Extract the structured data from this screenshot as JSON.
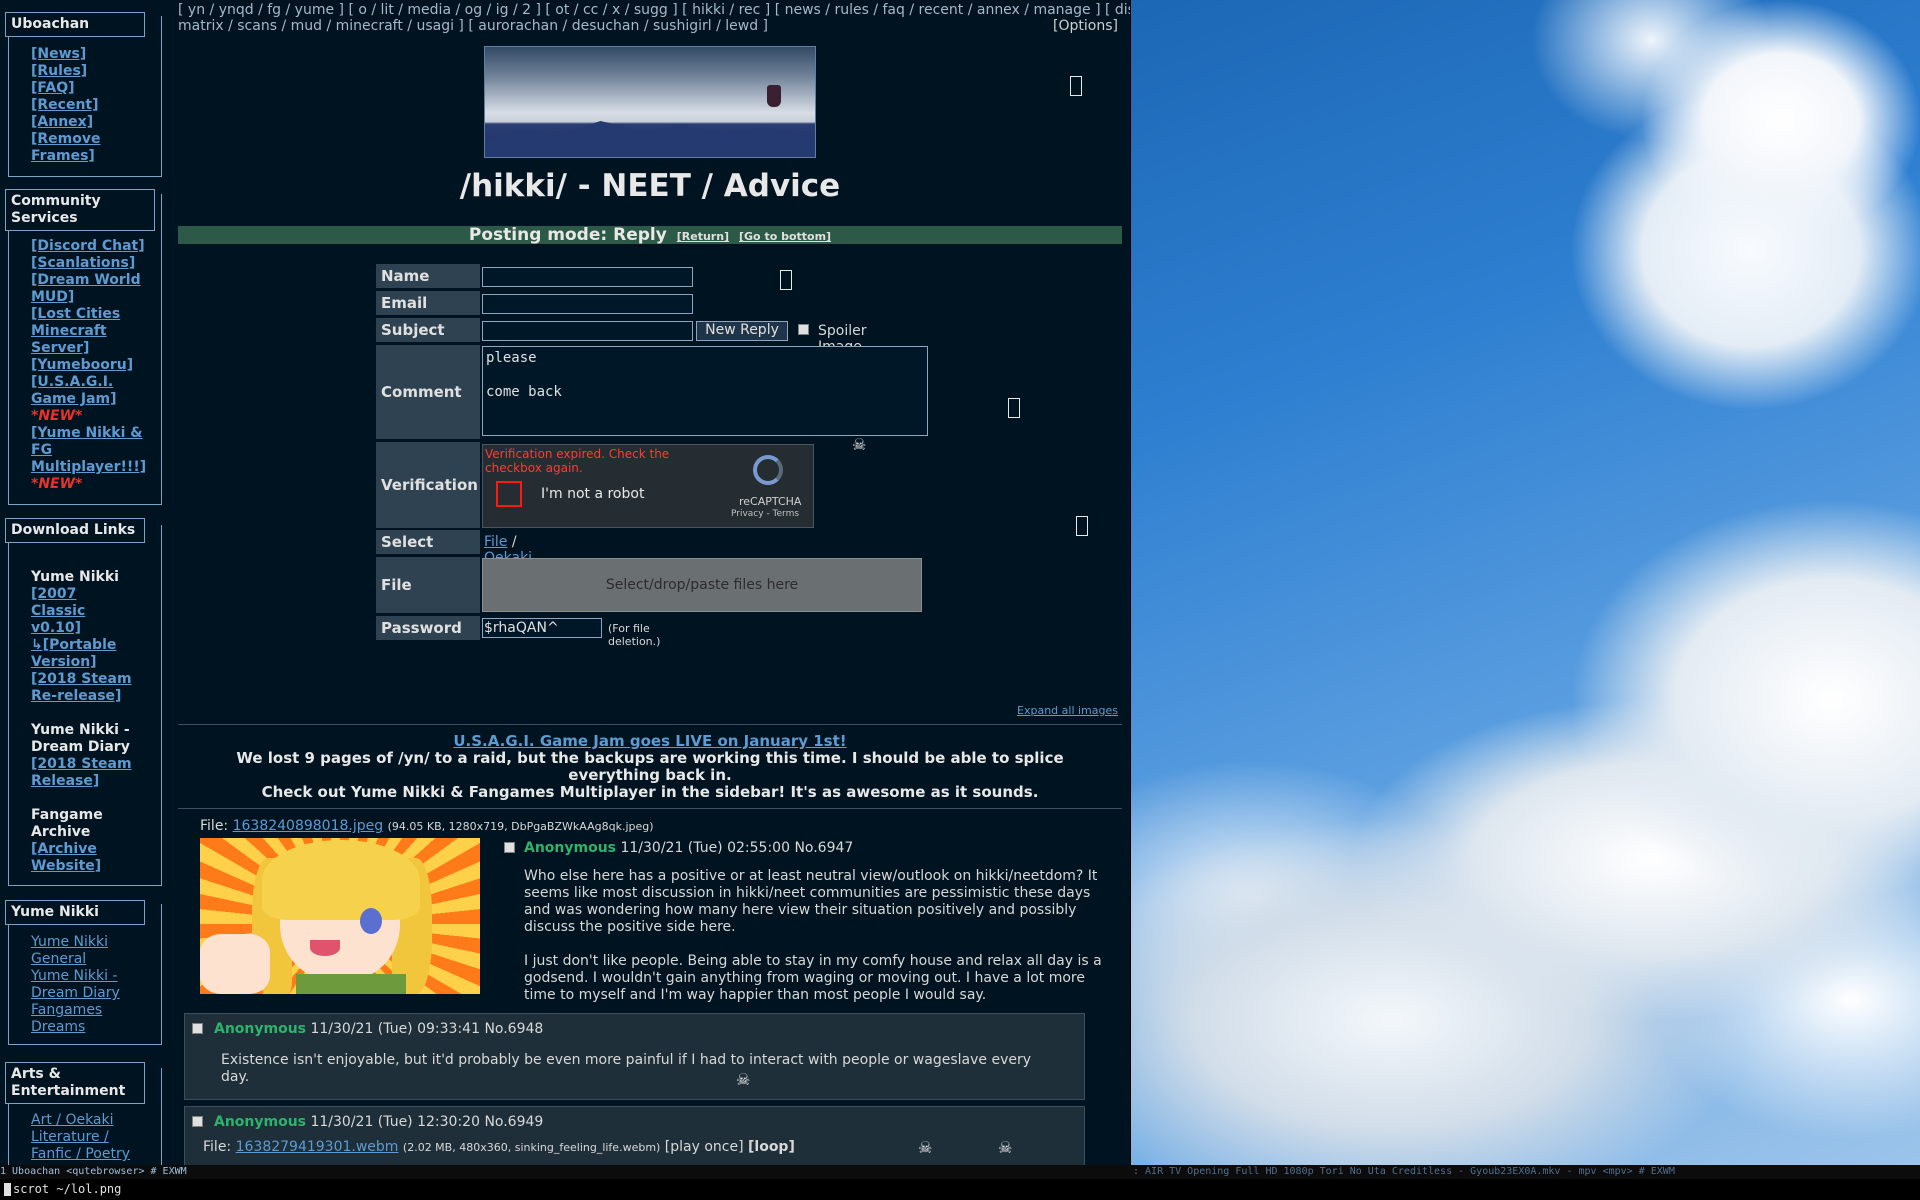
{
  "topnav": {
    "line1": "[ yn / ynqd / fg / yume ] [ o / lit / media / og / ig / 2 ] [ ot / cc / x / sugg ] [ hikki / rec ] [ news / rules / faq / recent / annex / manage ] [ discord /",
    "line2": "matrix / scans / mud / minecraft / usagi ] [ aurorachan / desuchan / sushigirl / lewd ]",
    "options": "[Options]"
  },
  "sidebar": {
    "uboachan": {
      "title": "Uboachan",
      "links": [
        "[News]",
        "[Rules]",
        "[FAQ]",
        "[Recent]",
        "[Annex]",
        "[Remove Frames]"
      ]
    },
    "community": {
      "title": "Community Services",
      "links": [
        "[Discord Chat]",
        "[Scanlations]",
        "[Dream World MUD]",
        "[Lost Cities Minecraft Server]",
        "[Yumebooru]",
        "[U.S.A.G.I. Game Jam]"
      ],
      "new1": "*NEW*",
      "multiplayer": "[Yume Nikki & FG Multiplayer!!!]",
      "new2": "*NEW*"
    },
    "downloads": {
      "title": "Download Links",
      "group1": "Yume Nikki",
      "classic": "[2007 Classic v0.10]",
      "portable": "↳[Portable Version]",
      "steam": "[2018 Steam Re-release]",
      "group2": "Yume Nikki - Dream Diary",
      "steam2": "[2018 Steam Release]",
      "group3": "Fangame Archive",
      "archive": "[Archive Website]"
    },
    "yumenikki": {
      "title": "Yume Nikki",
      "links": [
        "Yume Nikki General",
        "Yume Nikki - Dream Diary",
        "Fangames",
        "Dreams"
      ]
    },
    "arts": {
      "title": "Arts & Entertainment",
      "links": [
        "Art / Oekaki",
        "Literature / Fanfic / Poetry"
      ]
    }
  },
  "board": {
    "title": "/hikki/ - NEET / Advice",
    "mode": "Posting mode: Reply",
    "return": "[Return]",
    "bottom": "[Go to bottom]"
  },
  "form": {
    "name_label": "Name",
    "email_label": "Email",
    "subject_label": "Subject",
    "new_reply": "New Reply",
    "spoiler": "Spoiler Image",
    "comment_label": "Comment",
    "comment_value": "please\n\ncome back",
    "verification_label": "Verification",
    "captcha_expired": "Verification expired. Check the checkbox again.",
    "captcha_robot": "I'm not a robot",
    "captcha_brand": "reCAPTCHA",
    "captcha_terms": "Privacy - Terms",
    "select_label": "Select",
    "select_file": "File",
    "select_sep": "/",
    "select_oekaki": "Oekaki",
    "file_label": "File",
    "dropzone": "Select/drop/paste files here",
    "password_label": "Password",
    "password_value": "$rhaQAN^",
    "password_note": "(For file deletion.)"
  },
  "expand_all": "Expand all images",
  "announcement": {
    "link": "U.S.A.G.I. Game Jam goes LIVE on January 1st!",
    "line2": "We lost 9 pages of /yn/ to a raid, but the backups are working this time. I should be able to splice everything back in.",
    "line3": "Check out Yume Nikki & Fangames Multiplayer in the sidebar! It's as awesome as it sounds."
  },
  "op": {
    "file_prefix": "File:",
    "filename": "1638240898018.jpeg",
    "filemeta": "(94.05 KB, 1280x719, DbPgaBZWkAAg8qk.jpeg)",
    "name": "Anonymous",
    "date": "11/30/21 (Tue) 02:55:00",
    "no": "No.6947",
    "body1": "Who else here has a positive or at least neutral view/outlook on hikki/neetdom? It seems like most discussion in hikki/neet communities are pessimistic these days and was wondering how many here view their situation positively and possibly discuss the positive side here.",
    "body2": "I just don't like people. Being able to stay in my comfy house and relax all day is a godsend. I wouldn't gain anything from waging or moving out. I have a lot more time to myself and I'm way happier than most people I would say."
  },
  "replies": [
    {
      "name": "Anonymous",
      "date": "11/30/21 (Tue) 09:33:41",
      "no": "No.6948",
      "body": "Existence isn't enjoyable, but it'd probably be even more painful if I had to interact with people or wageslave every day."
    },
    {
      "name": "Anonymous",
      "date": "11/30/21 (Tue) 12:30:20",
      "no": "No.6949",
      "file_prefix": "File:",
      "filename": "1638279419301.webm",
      "filemeta": "(2.02 MB, 480x360, sinking_feeling_life.webm)",
      "play_once": "[play once]",
      "loop": "[loop]"
    }
  ],
  "statusbar": {
    "left": "1 Uboachan <qutebrowser> # EXWM",
    "right": ": AIR TV Opening Full HD 1080p Tori No Uta Creditless - Gyoub23EX0A.mkv - mpv <mpv> # EXWM"
  },
  "cmdline": "scrot ~/lol.png"
}
